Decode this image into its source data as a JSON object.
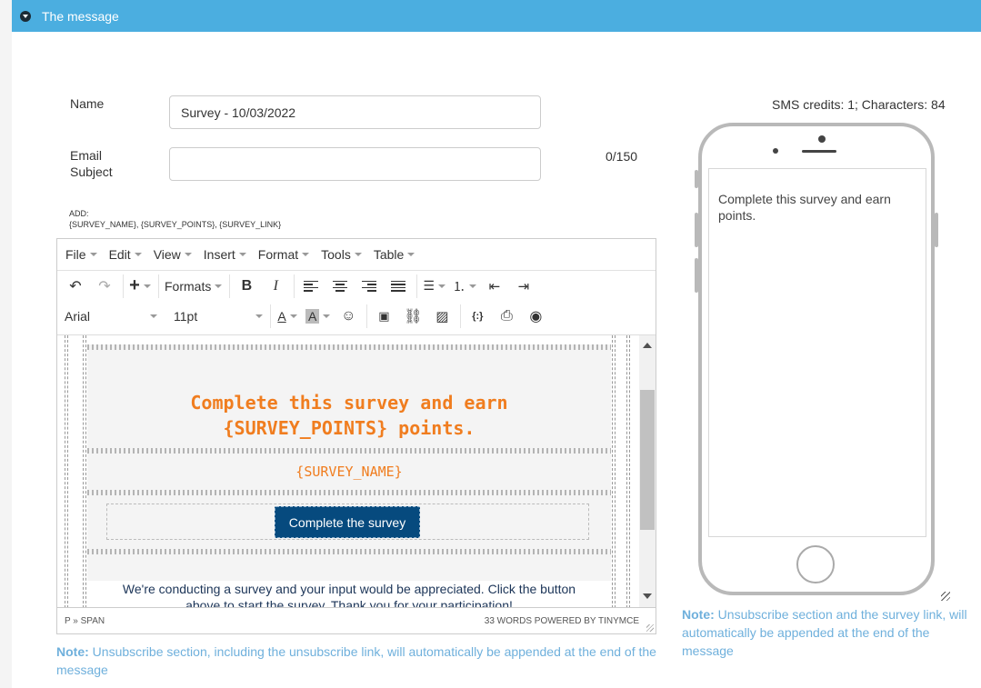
{
  "header": {
    "title": "The message"
  },
  "form": {
    "name_label": "Name",
    "name_value": "Survey - 10/03/2022",
    "subject_label_1": "Email",
    "subject_label_2": "Subject",
    "subject_value": "",
    "subject_counter": "0/150",
    "add_label": "ADD:",
    "add_tokens": "{SURVEY_NAME}, {SURVEY_POINTS}, {SURVEY_LINK}"
  },
  "editor": {
    "menu": [
      "File",
      "Edit",
      "View",
      "Insert",
      "Format",
      "Tools",
      "Table"
    ],
    "formats_label": "Formats",
    "font_family": "Arial",
    "font_size": "11pt",
    "icons": {
      "undo": "undo-icon",
      "redo": "redo-icon",
      "insert": "plus-icon",
      "bold": "bold-icon",
      "italic": "italic-icon",
      "align_left": "align-left-icon",
      "align_center": "align-center-icon",
      "align_right": "align-right-icon",
      "justify": "justify-icon",
      "bullets": "bullet-list-icon",
      "numbers": "numbered-list-icon",
      "outdent": "outdent-icon",
      "indent": "indent-icon",
      "text_color": "text-color-icon",
      "bg_color": "background-color-icon",
      "emoji": "emoji-icon",
      "media": "media-icon",
      "link": "link-icon",
      "image": "image-icon",
      "variables": "variables-icon",
      "print": "print-icon",
      "preview": "preview-icon"
    },
    "content": {
      "title_line1": "Complete this survey and earn",
      "title_line2": "{SURVEY_POINTS} points.",
      "survey_name": "{SURVEY_NAME}",
      "button": "Complete the survey",
      "body_line1": "We're conducting a survey and your input would be appreciated. Click the button",
      "body_line2": "above to start the survey. Thank you for your participation!"
    },
    "status_path": "P » SPAN",
    "status_right": "33 WORDS POWERED BY TINYMCE",
    "accent_orange": "#f07d1f",
    "button_color": "#064a7e"
  },
  "note_left": {
    "label": "Note:",
    "text": " Unsubscribe section, including the unsubscribe link, will automatically be appended at the end of the message"
  },
  "sms": {
    "credits": "SMS credits: 1; Characters: 84",
    "preview_text": "Complete this survey and earn points."
  },
  "note_right": {
    "label": "Note:",
    "text": " Unsubscribe section and the survey link, will automatically be appended at the end of the message"
  },
  "colors": {
    "header": "#4baee0",
    "note": "#6fb0dc"
  }
}
